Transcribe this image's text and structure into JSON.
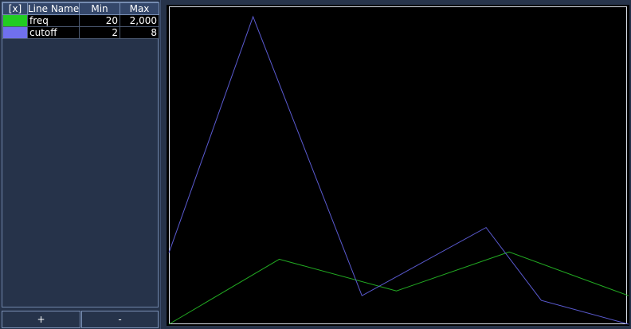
{
  "table": {
    "headers": [
      "[x]",
      "Line Name",
      "Min",
      "Max"
    ],
    "rows": [
      {
        "color": "#22cc22",
        "name": "freq",
        "min": "20",
        "max": "2,000"
      },
      {
        "color": "#7070ee",
        "name": "cutoff",
        "min": "2",
        "max": "8"
      }
    ]
  },
  "buttons": {
    "add_label": "+",
    "remove_label": "-"
  },
  "chart_data": {
    "type": "line",
    "x": [
      0,
      1,
      2,
      3,
      4,
      5,
      6
    ],
    "series": [
      {
        "name": "freq",
        "color": "#22aa22",
        "values": [
          20,
          270,
          215,
          330,
          180,
          null,
          null
        ],
        "x": [
          0,
          0.62,
          1.25,
          2.0,
          2.87,
          null,
          null
        ]
      },
      {
        "name": "cutoff",
        "color": "#5a5ad0",
        "values": [
          3,
          8,
          1.3,
          3.6,
          1.2,
          0.5,
          null
        ],
        "x": [
          0,
          0.46,
          1.07,
          1.74,
          2.07,
          2.52,
          null
        ]
      }
    ]
  }
}
